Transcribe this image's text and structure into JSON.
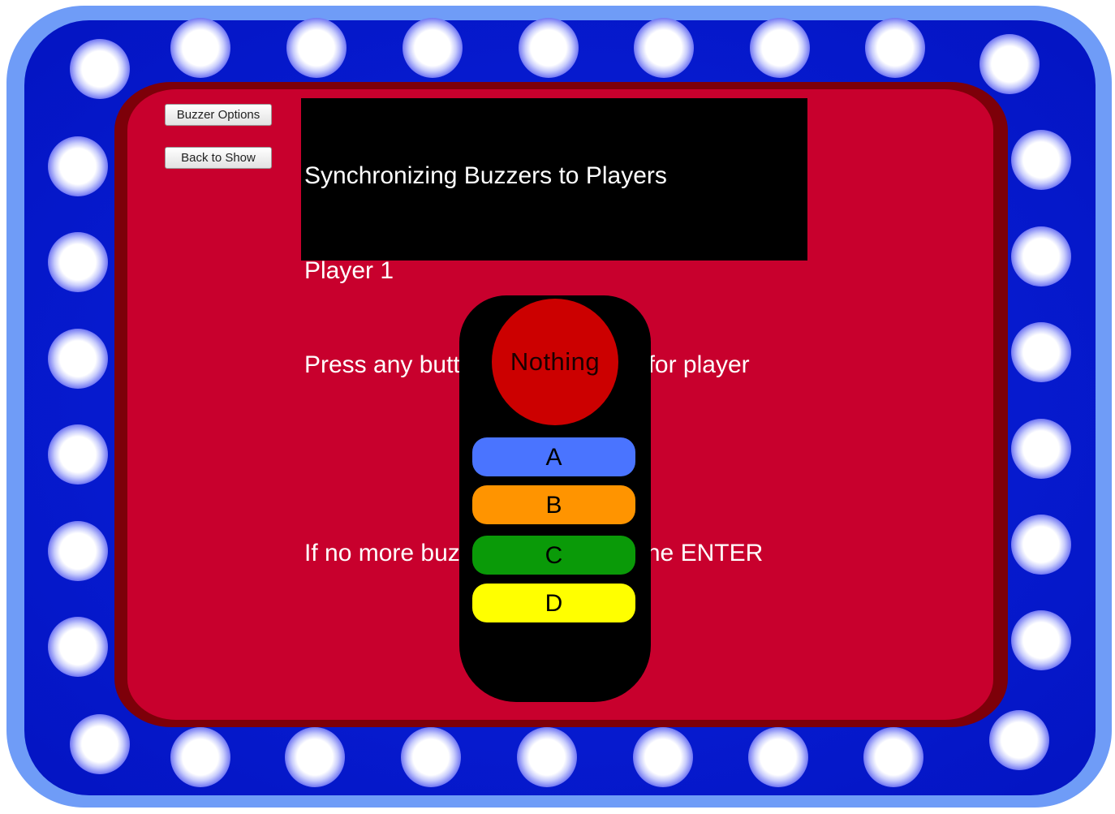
{
  "controls": {
    "buzzer_options": "Buzzer Options",
    "back_to_show": "Back to Show"
  },
  "message": {
    "lines": [
      "Synchronizing Buzzers to Players",
      "Player 1",
      "Press any button on the buzzer for player",
      "",
      "If no more buzzers, then press the ENTER"
    ]
  },
  "buzzer": {
    "big_button_label": "Nothing",
    "big_button_color": "#cc0000",
    "keys": [
      {
        "label": "A",
        "color": "#4a74ff"
      },
      {
        "label": "B",
        "color": "#ff9400"
      },
      {
        "label": "C",
        "color": "#0a9a08"
      },
      {
        "label": "D",
        "color": "#ffff00"
      }
    ]
  },
  "colors": {
    "frame_outer": "#6f9cf7",
    "frame_inner": "#061bd0",
    "panel": "#c8002d",
    "panel_border": "#7d0009"
  }
}
